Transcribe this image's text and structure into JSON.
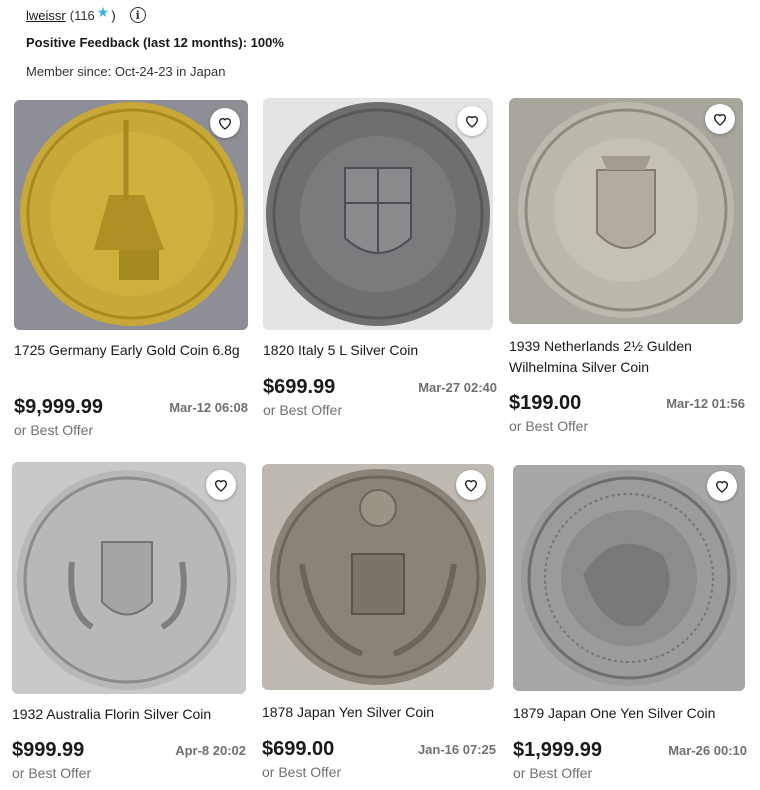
{
  "seller": {
    "name": "lweissr",
    "open": "(116",
    "star": "★",
    "close": ")",
    "info": "i",
    "feedback": "Positive Feedback (last 12 months): 100%",
    "member_since": "Member since: Oct-24-23 in Japan"
  },
  "listings": [
    {
      "title": "1725 Germany Early Gold Coin 6.8g",
      "price": "$9,999.99",
      "time": "Mar-12 06:08",
      "offer": "or Best Offer",
      "coin_color": "#c8a838"
    },
    {
      "title": "1820 Italy 5 L Silver Coin",
      "price": "$699.99",
      "time": "Mar-27 02:40",
      "offer": "or Best Offer",
      "coin_color": "#6f6f72"
    },
    {
      "title": "1939 Netherlands 2½ Gulden Wilhelmina Silver Coin",
      "price": "$199.00",
      "time": "Mar-12 01:56",
      "offer": "or Best Offer",
      "coin_color": "#a8a39a"
    },
    {
      "title": "1932 Australia Florin Silver Coin",
      "price": "$999.99",
      "time": "Apr-8 20:02",
      "offer": "or Best Offer",
      "coin_color": "#b8b8b6"
    },
    {
      "title": "1878 Japan Yen Silver Coin",
      "price": "$699.00",
      "time": "Jan-16 07:25",
      "offer": "or Best Offer",
      "coin_color": "#8a8378"
    },
    {
      "title": "1879 Japan One Yen Silver Coin",
      "price": "$1,999.99",
      "time": "Mar-26 00:10",
      "offer": "or Best Offer",
      "coin_color": "#9c9a9a"
    }
  ]
}
